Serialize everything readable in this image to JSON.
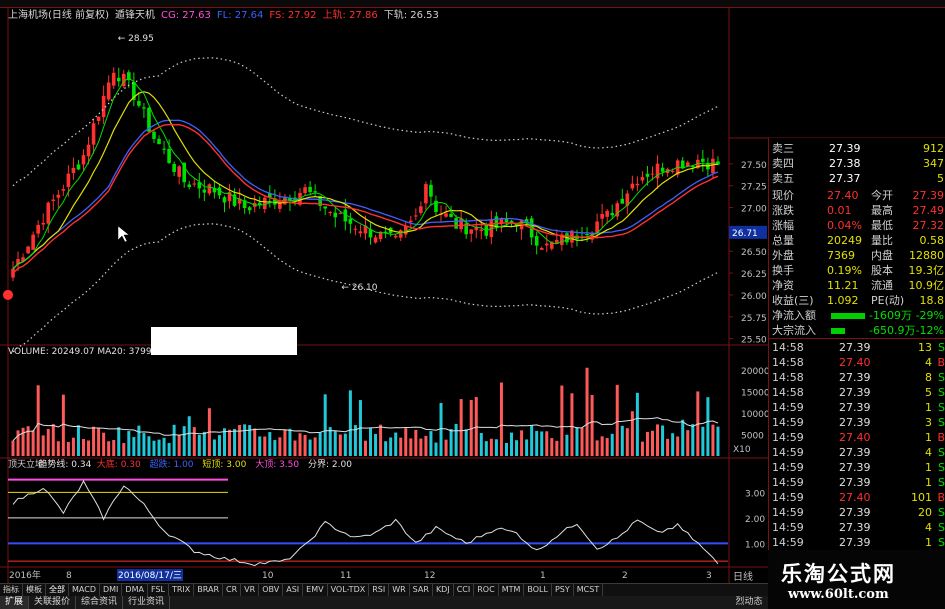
{
  "header": {
    "title": "上海机场(日线 前复权)",
    "indicator": "遁锋天机",
    "items": [
      {
        "label": "CG: 27.63",
        "color": "#ff4fe0"
      },
      {
        "label": "FL: 27.64",
        "color": "#4060ff"
      },
      {
        "label": "FS: 27.92",
        "color": "#ff3030"
      },
      {
        "label": "上轨: 27.86",
        "color": "#ff3030"
      },
      {
        "label": "下轨: 26.53",
        "color": "#d0d0d0"
      }
    ]
  },
  "price_axis": {
    "ticks": [
      "27.50",
      "27.25",
      "27.00",
      "26.75",
      "26.50",
      "26.25",
      "26.00",
      "25.75",
      "25.50"
    ]
  },
  "current_price_tag": "26.71",
  "price_annotations": {
    "high": "28.95",
    "low": "26.10"
  },
  "volume_header": {
    "label": "VOLUME: 20249.07",
    "ma20": "MA20: 37996"
  },
  "volume_axis": {
    "ticks": [
      "20000",
      "15000",
      "10000",
      "5000"
    ],
    "unit": "X10"
  },
  "osc_header": {
    "items": [
      {
        "label": "顶天立地",
        "color": "#d0d0d0"
      },
      {
        "label": "趋势线: 0.34",
        "color": "#e0e0e0"
      },
      {
        "label": "大底: 0.30",
        "color": "#ff3030"
      },
      {
        "label": "超跌: 1.00",
        "color": "#4060ff"
      },
      {
        "label": "短顶: 3.00",
        "color": "#e0e000"
      },
      {
        "label": "大顶: 3.50",
        "color": "#ff4fe0"
      },
      {
        "label": "分界: 2.00",
        "color": "#e0e0e0"
      }
    ]
  },
  "osc_axis": {
    "ticks": [
      "3.00",
      "2.00",
      "1.00"
    ]
  },
  "time_axis": {
    "year": "2016年",
    "labels": [
      "8",
      "2016/08/17/三",
      "10",
      "11",
      "12",
      "1",
      "2",
      "3"
    ],
    "period": "日线"
  },
  "quote_panel": {
    "asks": [
      {
        "label": "卖三",
        "price": "27.39",
        "vol": "912"
      },
      {
        "label": "卖四",
        "price": "27.38",
        "vol": "347"
      },
      {
        "label": "卖五",
        "price": "27.37",
        "vol": "5"
      }
    ],
    "stats": [
      {
        "l1": "现价",
        "v1": "27.40",
        "l2": "今开",
        "v2": "27.39"
      },
      {
        "l1": "涨跌",
        "v1": "0.01",
        "l2": "最高",
        "v2": "27.49"
      },
      {
        "l1": "涨幅",
        "v1": "0.04%",
        "l2": "最低",
        "v2": "27.32"
      },
      {
        "l1": "总量",
        "v1": "20249",
        "l2": "量比",
        "v2": "0.58"
      },
      {
        "l1": "外盘",
        "v1": "7369",
        "l2": "内盘",
        "v2": "12880"
      },
      {
        "l1": "换手",
        "v1": "0.19%",
        "l2": "股本",
        "v2": "19.3亿"
      },
      {
        "l1": "净资",
        "v1": "11.21",
        "l2": "流通",
        "v2": "10.9亿"
      },
      {
        "l1": "收益(三)",
        "v1": "1.092",
        "l2": "PE(动)",
        "v2": "18.8"
      }
    ],
    "flows": [
      {
        "label": "净流入额",
        "value": "-1609万",
        "pct": "-29%"
      },
      {
        "label": "大宗流入",
        "value": "-650.9万",
        "pct": "-12%"
      }
    ],
    "ticks": [
      {
        "time": "14:58",
        "price": "27.39",
        "vol": "13",
        "flag": "S"
      },
      {
        "time": "14:58",
        "price": "27.40",
        "vol": "4",
        "flag": "B"
      },
      {
        "time": "14:58",
        "price": "27.39",
        "vol": "8",
        "flag": "S"
      },
      {
        "time": "14:58",
        "price": "27.39",
        "vol": "5",
        "flag": "S"
      },
      {
        "time": "14:59",
        "price": "27.39",
        "vol": "1",
        "flag": "S"
      },
      {
        "time": "14:59",
        "price": "27.39",
        "vol": "3",
        "flag": "S"
      },
      {
        "time": "14:59",
        "price": "27.40",
        "vol": "1",
        "flag": "B"
      },
      {
        "time": "14:59",
        "price": "27.39",
        "vol": "4",
        "flag": "S"
      },
      {
        "time": "14:59",
        "price": "27.39",
        "vol": "1",
        "flag": "S"
      },
      {
        "time": "14:59",
        "price": "27.39",
        "vol": "1",
        "flag": "S"
      },
      {
        "time": "14:59",
        "price": "27.40",
        "vol": "101",
        "flag": "B"
      },
      {
        "time": "14:59",
        "price": "27.39",
        "vol": "20",
        "flag": "S"
      },
      {
        "time": "14:59",
        "price": "27.39",
        "vol": "4",
        "flag": "S"
      },
      {
        "time": "14:59",
        "price": "27.39",
        "vol": "1",
        "flag": "S"
      }
    ]
  },
  "indicator_tabs": [
    "指标",
    "模板",
    "全部",
    "MACD",
    "DMI",
    "DMA",
    "FSL",
    "TRIX",
    "BRAR",
    "CR",
    "VR",
    "OBV",
    "ASI",
    "EMV",
    "VOL-TDX",
    "RSI",
    "WR",
    "SAR",
    "KDJ",
    "CCI",
    "ROC",
    "MTM",
    "BOLL",
    "PSY",
    "MCST"
  ],
  "bottom_tabs": [
    "扩展",
    "关联报价",
    "综合资讯",
    "行业资讯"
  ],
  "corner_tab": "烈动态",
  "logo": {
    "cn": "乐淘公式网",
    "url": "www.60lt.com"
  },
  "colors": {
    "up": "#ff3030",
    "down": "#00e000",
    "bg": "#000000",
    "grid": "#7a1010"
  }
}
